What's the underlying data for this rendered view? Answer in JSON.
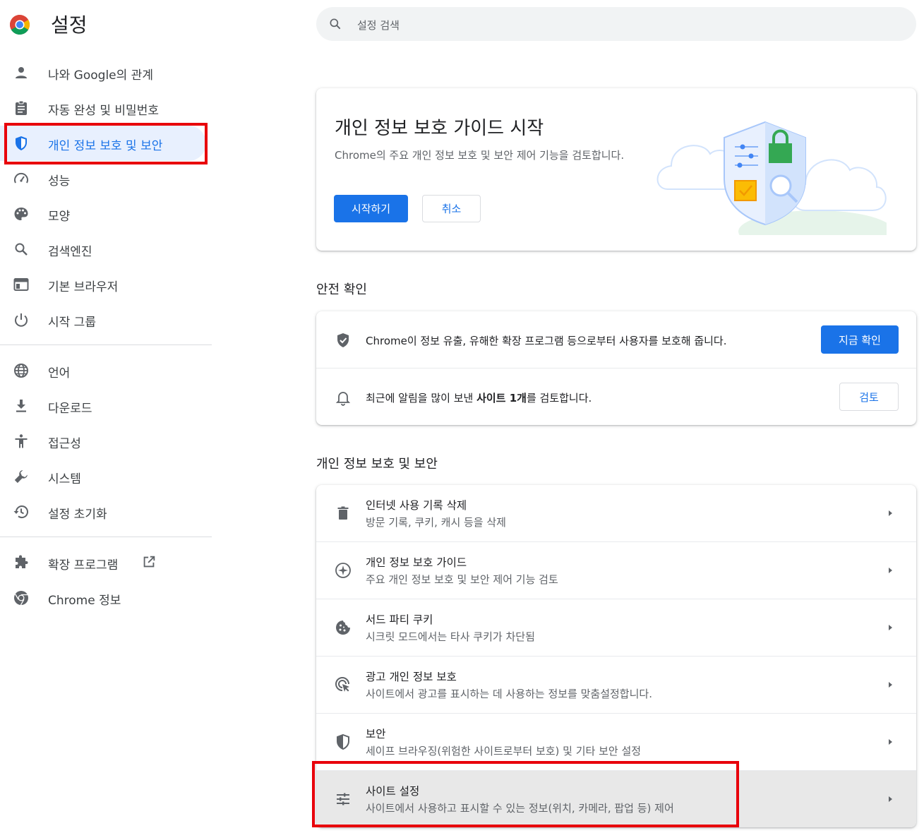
{
  "header": {
    "title": "설정",
    "search_placeholder": "설정 검색"
  },
  "sidebar": {
    "items": [
      {
        "label": "나와 Google의 관계",
        "icon": "person-icon"
      },
      {
        "label": "자동 완성 및 비밀번호",
        "icon": "clipboard-icon"
      },
      {
        "label": "개인 정보 보호 및 보안",
        "icon": "shield-icon",
        "active": true
      },
      {
        "label": "성능",
        "icon": "speedometer-icon"
      },
      {
        "label": "모양",
        "icon": "palette-icon"
      },
      {
        "label": "검색엔진",
        "icon": "search-icon"
      },
      {
        "label": "기본 브라우저",
        "icon": "browser-window-icon"
      },
      {
        "label": "시작 그룹",
        "icon": "power-icon"
      }
    ],
    "items2": [
      {
        "label": "언어",
        "icon": "globe-icon"
      },
      {
        "label": "다운로드",
        "icon": "download-icon"
      },
      {
        "label": "접근성",
        "icon": "accessibility-icon"
      },
      {
        "label": "시스템",
        "icon": "wrench-icon"
      },
      {
        "label": "설정 초기화",
        "icon": "restore-icon"
      }
    ],
    "items3": [
      {
        "label": "확장 프로그램",
        "icon": "puzzle-icon"
      },
      {
        "label": "Chrome 정보",
        "icon": "chrome-icon"
      }
    ]
  },
  "guide": {
    "title": "개인 정보 보호 가이드 시작",
    "desc": "Chrome의 주요 개인 정보 보호 및 보안 제어 기능을 검토합니다.",
    "start_label": "시작하기",
    "cancel_label": "취소"
  },
  "safety": {
    "section_title": "안전 확인",
    "row1_text": "Chrome이 정보 유출, 유해한 확장 프로그램 등으로부터 사용자를 보호해 줍니다.",
    "row1_button": "지금 확인",
    "row2_prefix": "최근에 알림을 많이 보낸 ",
    "row2_bold": "사이트 1개",
    "row2_suffix": "를 검토합니다.",
    "row2_button": "검토"
  },
  "privacy": {
    "section_title": "개인 정보 보호 및 보안",
    "rows": [
      {
        "title": "인터넷 사용 기록 삭제",
        "sub": "방문 기록, 쿠키, 캐시 등을 삭제",
        "icon": "trash-icon"
      },
      {
        "title": "개인 정보 보호 가이드",
        "sub": "주요 개인 정보 보호 및 보안 제어 기능 검토",
        "icon": "compass-icon"
      },
      {
        "title": "서드 파티 쿠키",
        "sub": "시크릿 모드에서는 타사 쿠키가 차단됨",
        "icon": "cookie-icon"
      },
      {
        "title": "광고 개인 정보 보호",
        "sub": "사이트에서 광고를 표시하는 데 사용하는 정보를 맞춤설정합니다.",
        "icon": "ad-target-icon"
      },
      {
        "title": "보안",
        "sub": "세이프 브라우징(위험한 사이트로부터 보호) 및 기타 보안 설정",
        "icon": "shield-half-icon"
      },
      {
        "title": "사이트 설정",
        "sub": "사이트에서 사용하고 표시할 수 있는 정보(위치, 카메라, 팝업 등) 제어",
        "icon": "sliders-icon"
      }
    ]
  },
  "colors": {
    "accent": "#1a73e8",
    "highlight": "#e8000b",
    "active_bg": "#e8f0fe"
  }
}
